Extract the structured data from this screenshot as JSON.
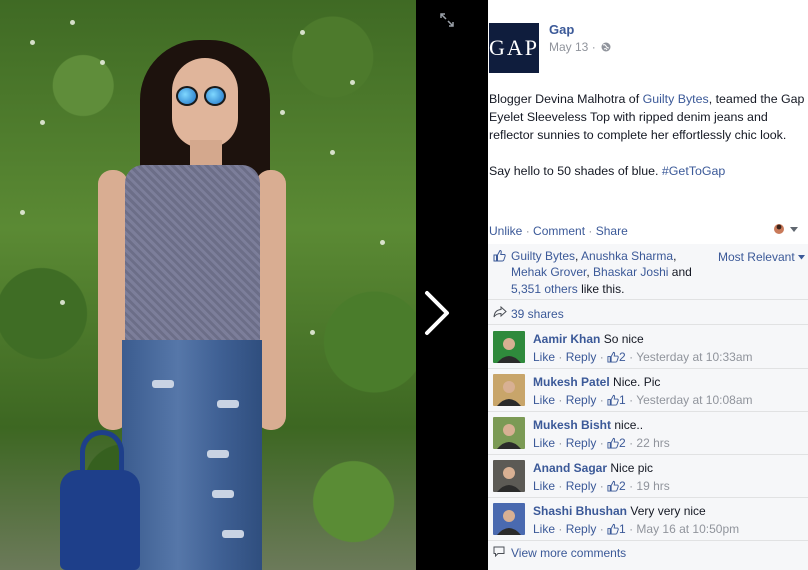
{
  "page": {
    "name": "Gap",
    "logo_text": "GAP",
    "date": "May 13",
    "date_separator": "·"
  },
  "post": {
    "paragraph1_prefix": "Blogger Devina Malhotra of ",
    "paragraph1_link": "Guilty Bytes",
    "paragraph1_suffix": ", teamed the Gap Eyelet Sleeveless Top with ripped denim jeans and reflector sunnies to complete her effortlessly chic look.",
    "paragraph2_prefix": "Say hello to 50 shades of blue. ",
    "hashtag": "#GetToGap"
  },
  "actions": {
    "unlike": "Unlike",
    "comment": "Comment",
    "share": "Share",
    "separator": " · "
  },
  "likes": {
    "names": [
      "Guilty Bytes",
      "Anushka Sharma",
      "Mehak Grover",
      "Bhaskar Joshi"
    ],
    "and_text": "and",
    "others": "5,351 others",
    "suffix": "like this.",
    "sort_label": "Most Relevant"
  },
  "shares": {
    "label": "39 shares"
  },
  "comments": [
    {
      "author": "Aamir Khan",
      "text": "So nice",
      "like": "Like",
      "reply": "Reply",
      "likes": "2",
      "time": "Yesterday at 10:33am",
      "avatar_color": "#2f8a3c"
    },
    {
      "author": "Mukesh Patel",
      "text": "Nice. Pic",
      "like": "Like",
      "reply": "Reply",
      "likes": "1",
      "time": "Yesterday at 10:08am",
      "avatar_color": "#c8a56a"
    },
    {
      "author": "Mukesh Bisht",
      "text": "nice..",
      "like": "Like",
      "reply": "Reply",
      "likes": "2",
      "time": "22 hrs",
      "avatar_color": "#7b9a55"
    },
    {
      "author": "Anand Sagar",
      "text": "Nice pic",
      "like": "Like",
      "reply": "Reply",
      "likes": "2",
      "time": "19 hrs",
      "avatar_color": "#5c5a55"
    },
    {
      "author": "Shashi Bhushan",
      "text": "Very very nice",
      "like": "Like",
      "reply": "Reply",
      "likes": "1",
      "time": "May 16 at 10:50pm",
      "avatar_color": "#4a6ab0"
    }
  ],
  "view_more": "View more comments",
  "colors": {
    "link": "#3b5998",
    "meta": "#90949c",
    "ufi_bg": "#f6f7f9",
    "logo_bg": "#0f1d3d"
  }
}
